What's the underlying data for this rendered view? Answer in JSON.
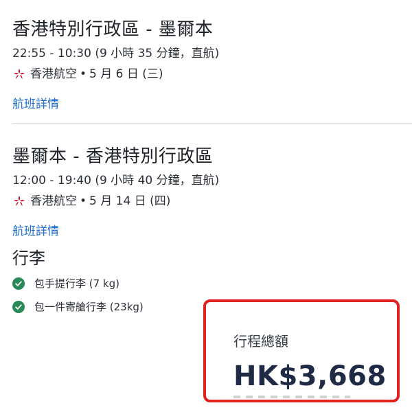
{
  "outbound": {
    "route": "香港特別行政區 - 墨爾本",
    "times": "22:55 - 10:30 (9 小時 35 分鐘，直航)",
    "airline": "香港航空",
    "date": "5 月 6 日 (三)",
    "details_link": "航班詳情"
  },
  "return": {
    "route": "墨爾本 - 香港特別行政區",
    "times": "12:00 - 19:40 (9 小時 40 分鐘，直航)",
    "airline": "香港航空",
    "date": "5 月 14 日 (四)",
    "details_link": "航班詳情"
  },
  "baggage": {
    "title": "行李",
    "items": [
      {
        "label": "包手提行李 (7 kg)",
        "icon": "check-circle-icon"
      },
      {
        "label": "包一件寄艙行李 (23kg)",
        "icon": "check-circle-icon"
      }
    ]
  },
  "total": {
    "label": "行程總額",
    "price": "HK$3,668"
  },
  "colors": {
    "link": "#1f6fd1",
    "check": "#2a8a57",
    "highlight_border": "#e0211f",
    "price_text": "#1f2a44",
    "airline_logo": "#c8102e"
  }
}
